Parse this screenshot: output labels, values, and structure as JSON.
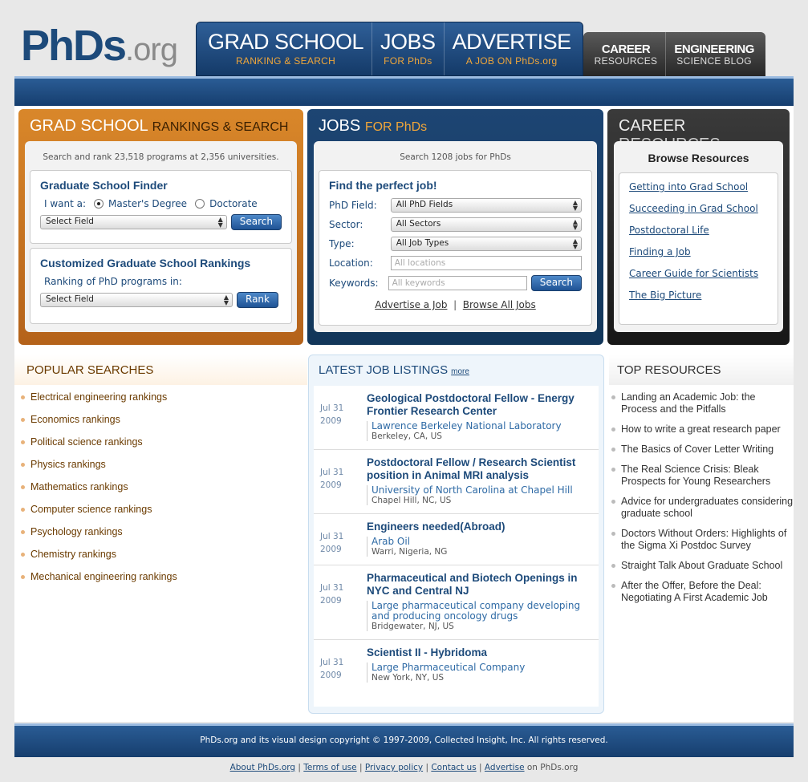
{
  "logo": {
    "main": "PhDs",
    "ext": ".org"
  },
  "topnav": {
    "main": [
      {
        "big": "GRAD SCHOOL",
        "small": "RANKING & SEARCH"
      },
      {
        "big": "JOBS",
        "small": "FOR PhDs"
      },
      {
        "big": "ADVERTISE",
        "small": "A JOB ON PhDs.org"
      }
    ],
    "dark": [
      {
        "big": "CAREER",
        "small": "RESOURCES"
      },
      {
        "big": "ENGINEERING",
        "small": "SCIENCE BLOG"
      }
    ]
  },
  "grad": {
    "title": "GRAD SCHOOL",
    "title_hl": "RANKINGS & SEARCH",
    "intro": "Search and rank 23,518 programs at 2,356 universities.",
    "finder_title": "Graduate School Finder",
    "iwant": "I want a:",
    "opt1": "Master's Degree",
    "opt2": "Doctorate",
    "select": "Select Field",
    "search_btn": "Search",
    "rank_title": "Customized Graduate School Rankings",
    "rank_sub": "Ranking of PhD programs in:",
    "rank_select": "Select Field",
    "rank_btn": "Rank"
  },
  "jobs": {
    "title": "JOBS",
    "title_hl": "FOR PhDs",
    "intro": "Search 1208 jobs for PhDs",
    "card_title": "Find the perfect job!",
    "field_label": "PhD Field:",
    "field_value": "All PhD Fields",
    "sector_label": "Sector:",
    "sector_value": "All Sectors",
    "type_label": "Type:",
    "type_value": "All Job Types",
    "location_label": "Location:",
    "location_ph": "All locations",
    "keywords_label": "Keywords:",
    "keywords_ph": "All keywords",
    "search_btn": "Search",
    "advertise_link": "Advertise a Job",
    "sep": "|",
    "browse_link": "Browse All Jobs"
  },
  "career": {
    "title": "CAREER",
    "title_hl": "RESOURCES",
    "browse": "Browse Resources",
    "links": [
      "Getting into Grad School",
      "Succeeding in Grad School",
      "Postdoctoral Life",
      "Finding a Job",
      "Career Guide for Scientists",
      "The Big Picture"
    ]
  },
  "popular": {
    "title": "POPULAR SEARCHES",
    "items": [
      "Electrical engineering rankings",
      "Economics rankings",
      "Political science rankings",
      "Physics rankings",
      "Mathematics rankings",
      "Computer science rankings",
      "Psychology rankings",
      "Chemistry rankings",
      "Mechanical engineering rankings"
    ]
  },
  "latest": {
    "title": "LATEST JOB LISTINGS",
    "more": "more",
    "items": [
      {
        "month": "Jul 31",
        "year": "2009",
        "title": "Geological Postdoctoral Fellow - Energy Frontier Research Center",
        "company": "Lawrence Berkeley National Laboratory",
        "location": "Berkeley, CA, US"
      },
      {
        "month": "Jul 31",
        "year": "2009",
        "title": "Postdoctoral Fellow / Research Scientist position in Animal MRI analysis",
        "company": "University of North Carolina at Chapel Hill",
        "location": "Chapel Hill, NC, US"
      },
      {
        "month": "Jul 31",
        "year": "2009",
        "title": "Engineers needed(Abroad)",
        "company": "Arab Oil",
        "location": "Warri, Nigeria, NG"
      },
      {
        "month": "Jul 31",
        "year": "2009",
        "title": "Pharmaceutical and Biotech Openings in NYC and Central NJ",
        "company": "Large pharmaceutical company developing and producing oncology drugs",
        "location": "Bridgewater, NJ, US"
      },
      {
        "month": "Jul 31",
        "year": "2009",
        "title": "Scientist II - Hybridoma",
        "company": "Large Pharmaceutical Company",
        "location": "New York, NY, US"
      }
    ]
  },
  "top": {
    "title": "TOP RESOURCES",
    "items": [
      "Landing an Academic Job: the Process and the Pitfalls",
      "How to write a great research paper",
      "The Basics of Cover Letter Writing",
      "The Real Science Crisis: Bleak Prospects for Young Researchers",
      "Advice for undergraduates considering graduate school",
      "Doctors Without Orders: Highlights of the Sigma Xi Postdoc Survey",
      "Straight Talk About Graduate School",
      "After the Offer, Before the Deal: Negotiating A First Academic Job"
    ]
  },
  "footer": {
    "copyright": "PhDs.org and its visual design copyright © 1997-2009, Collected Insight, Inc. All rights reserved.",
    "links": [
      "About PhDs.org",
      "Terms of use",
      "Privacy policy",
      "Contact us",
      "Advertise"
    ],
    "sep": "|",
    "suffix": "on PhDs.org"
  }
}
